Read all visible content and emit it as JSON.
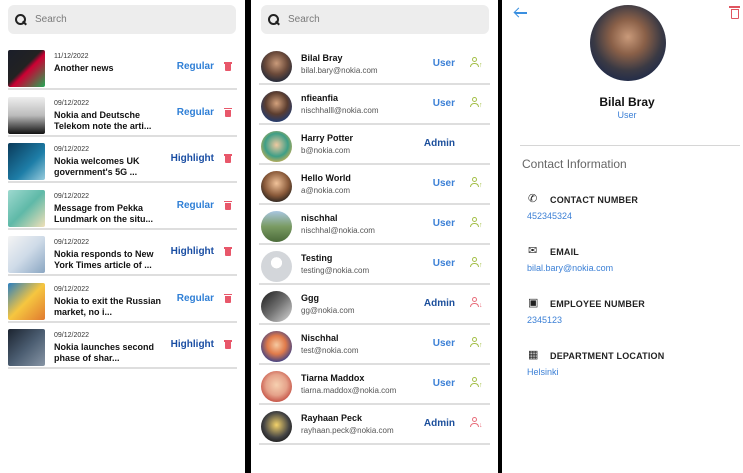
{
  "news_panel": {
    "search_placeholder": "Search",
    "items": [
      {
        "date": "11/12/2022",
        "title": "Another news",
        "type": "Regular",
        "type_class": "regular",
        "thumb": "linear-gradient(135deg,#1b1e2a 0%,#222 45%,#c03 55%,#2a5 100%)"
      },
      {
        "date": "09/12/2022",
        "title": "Nokia and Deutsche Telekom note the arti...",
        "type": "Regular",
        "type_class": "regular",
        "thumb": "linear-gradient(180deg,#eee 0%,#bbb 50%,#111 100%)"
      },
      {
        "date": "09/12/2022",
        "title": "Nokia welcomes UK government's 5G ...",
        "type": "Highlight",
        "type_class": "highlight",
        "thumb": "linear-gradient(135deg,#0a3a5a 0%,#1e7ea8 60%,#9cd 100%)"
      },
      {
        "date": "09/12/2022",
        "title": "Message from Pekka Lundmark on the situ...",
        "type": "Regular",
        "type_class": "regular",
        "thumb": "linear-gradient(135deg,#9ed9cf 0%,#5fb9a8 50%,#f1e0b8 100%)"
      },
      {
        "date": "09/12/2022",
        "title": "Nokia responds to New York Times article of ...",
        "type": "Highlight",
        "type_class": "highlight",
        "thumb": "linear-gradient(135deg,#f4f4f4 0%,#cfdbe8 50%,#8aa6c2 100%)"
      },
      {
        "date": "09/12/2022",
        "title": "Nokia to exit the Russian market, no i...",
        "type": "Regular",
        "type_class": "regular",
        "thumb": "linear-gradient(135deg,#2a7fc0 0%,#f6c640 50%,#e07a2f 100%)"
      },
      {
        "date": "09/12/2022",
        "title": "Nokia launches second phase of shar...",
        "type": "Highlight",
        "type_class": "highlight",
        "thumb": "linear-gradient(135deg,#1c2430 0%,#4a5c70 50%,#8795a5 100%)"
      }
    ]
  },
  "users_panel": {
    "search_placeholder": "Search",
    "users": [
      {
        "name": "Bilal Bray",
        "email": "bilal.bary@nokia.com",
        "role": "User",
        "role_class": "user",
        "action": "promote",
        "avatar": "radial-gradient(circle at 50% 40%,#c99a7a 0%,#6b4a3a 45%,#2a2d3a 75%)"
      },
      {
        "name": "nfieanfia",
        "email": "nischhalll@nokia.com",
        "role": "User",
        "role_class": "user",
        "action": "promote",
        "avatar": "radial-gradient(circle at 50% 40%,#d3a17c 0%,#5b3d2f 45%,#1f3b73 80%)"
      },
      {
        "name": "Harry Potter",
        "email": "b@nokia.com",
        "role": "Admin",
        "role_class": "admin",
        "action": "none",
        "avatar": "radial-gradient(circle at 50% 45%,#f0c9a0 0%,#3e9e86 50%,#e6b24a 85%)"
      },
      {
        "name": "Hello World",
        "email": "a@nokia.com",
        "role": "User",
        "role_class": "user",
        "action": "promote",
        "avatar": "radial-gradient(circle at 50% 40%,#f1c39a 0%,#8a5a3a 50%,#1b1b1b 85%)"
      },
      {
        "name": "nischhal",
        "email": "nischhal@nokia.com",
        "role": "User",
        "role_class": "user",
        "action": "promote",
        "avatar": "linear-gradient(180deg,#a8c6e0 0%,#7a9b63 50%,#4b6b3a 100%)"
      },
      {
        "name": "Testing",
        "email": "testing@nokia.com",
        "role": "User",
        "role_class": "user",
        "action": "promote",
        "avatar": "radial-gradient(circle at 50% 38%,#ffffff 0%,#ffffff 22%,#d3d6da 23%,#d3d6da 100%)"
      },
      {
        "name": "Ggg",
        "email": "gg@nokia.com",
        "role": "Admin",
        "role_class": "admin",
        "action": "demote",
        "avatar": "linear-gradient(135deg,#1a1a1a 0%,#6f6f6f 50%,#d8d8d8 100%)"
      },
      {
        "name": "Nischhal",
        "email": "test@nokia.com",
        "role": "User",
        "role_class": "user",
        "action": "promote",
        "avatar": "radial-gradient(circle at 50% 45%,#f6c9a0 0%,#e07a4a 40%,#2b3a8c 80%)"
      },
      {
        "name": "Tiarna Maddox",
        "email": "tiarna.maddox@nokia.com",
        "role": "User",
        "role_class": "user",
        "action": "promote",
        "avatar": "radial-gradient(circle at 50% 45%,#f6d0b0 0%,#e5a28a 45%,#c0473c 80%)"
      },
      {
        "name": "Rayhaan Peck",
        "email": "rayhaan.peck@nokia.com",
        "role": "Admin",
        "role_class": "admin",
        "action": "demote",
        "avatar": "radial-gradient(circle at 50% 45%,#f4d36a 0%,#444 55%,#111 85%)"
      }
    ]
  },
  "profile_panel": {
    "name": "Bilal Bray",
    "role": "User",
    "section_title": "Contact Information",
    "fields": [
      {
        "icon": "phone-icon",
        "glyph": "✆",
        "label": "CONTACT NUMBER",
        "value": "452345324"
      },
      {
        "icon": "email-icon",
        "glyph": "✉",
        "label": "EMAIL",
        "value": "bilal.bary@nokia.com"
      },
      {
        "icon": "id-card-icon",
        "glyph": "▣",
        "label": "EMPLOYEE NUMBER",
        "value": "2345123"
      },
      {
        "icon": "building-icon",
        "glyph": "▦",
        "label": "DEPARTMENT LOCATION",
        "value": "Helsinki"
      }
    ]
  },
  "colors": {
    "accent": "#3c80d6",
    "admin": "#1c4f9c",
    "delete": "#e8576a",
    "promote": "#a5c04a",
    "demote": "#e8707c"
  }
}
